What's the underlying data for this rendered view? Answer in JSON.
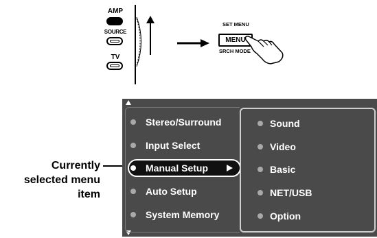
{
  "remote": {
    "amp_label": "AMP",
    "source_label": "SOURCE",
    "tv_label": "TV",
    "set_menu_label": "SET MENU",
    "menu_button_label": "MENU",
    "srch_mode_label": "SRCH MODE"
  },
  "menu": {
    "left_items": [
      {
        "label": "Stereo/Surround"
      },
      {
        "label": "Input Select"
      },
      {
        "label": "Manual Setup"
      },
      {
        "label": "Auto Setup"
      },
      {
        "label": "System Memory"
      }
    ],
    "selected_index": 2,
    "right_items": [
      {
        "label": "Sound"
      },
      {
        "label": "Video"
      },
      {
        "label": "Basic"
      },
      {
        "label": "NET/USB"
      },
      {
        "label": "Option"
      }
    ]
  },
  "callout": {
    "line1": "Currently",
    "line2": "selected menu",
    "line3": "item"
  },
  "colors": {
    "panel_bg": "#4a4a4a",
    "item_text": "#ffffff",
    "dot": "#a8a8a8",
    "selected_bg": "#111111"
  }
}
